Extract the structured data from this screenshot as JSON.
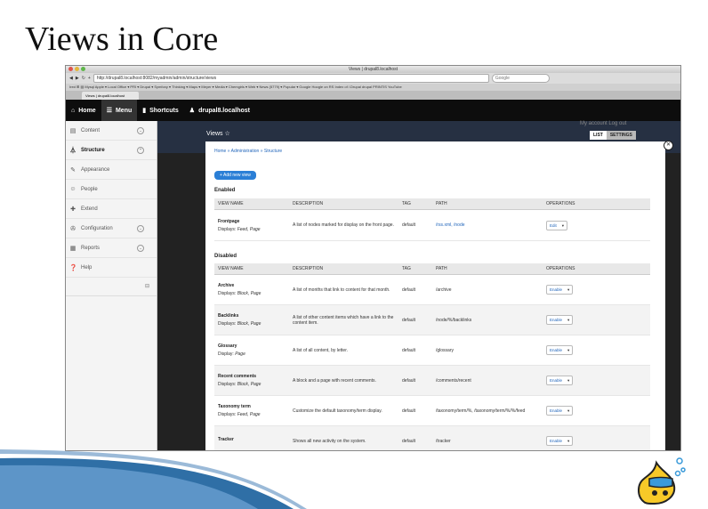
{
  "slide": {
    "title": "Views in Core"
  },
  "browser": {
    "window_title": "Views | drupal8.localhost",
    "url": "http://drupal8.localhost:8082/myadmin/admin/structure/views",
    "search_placeholder": "Google",
    "bookmarks": "Ired   ⊞  ▤   Mysql   Apple ▾   Local Office ▾   PRI ▾   Drupal ▾   Symfony ▾   Thinking ▾   Maps ▾   Meyer ▾   Media ▾   Chemgirls ▾   Web ▾   News (5779) ▾   Popular ▾   Google   Hoogle on RS   Index of /.Drupal drupal   PRINTIS   YouTube",
    "tab_label": "Views | drupal8.localhost"
  },
  "toolbar": {
    "home": "Home",
    "menu": "Menu",
    "shortcuts": "Shortcuts",
    "user": "drupal8.localhost"
  },
  "sidebar": {
    "items": [
      {
        "label": "Content",
        "icon": "content-icon"
      },
      {
        "label": "Structure",
        "icon": "structure-icon"
      },
      {
        "label": "Appearance",
        "icon": "appearance-icon"
      },
      {
        "label": "People",
        "icon": "people-icon"
      },
      {
        "label": "Extend",
        "icon": "extend-icon"
      },
      {
        "label": "Configuration",
        "icon": "configuration-icon"
      },
      {
        "label": "Reports",
        "icon": "reports-icon"
      },
      {
        "label": "Help",
        "icon": "help-icon"
      }
    ]
  },
  "page": {
    "title": "Views ☆",
    "account_links": "My account    Log out",
    "tab_list": "LIST",
    "tab_settings": "SETTINGS",
    "breadcrumb": "Home » Administration » Structure",
    "add_button": "+ Add new view",
    "enabled_heading": "Enabled",
    "disabled_heading": "Disabled",
    "columns": [
      "VIEW NAME",
      "DESCRIPTION",
      "TAG",
      "PATH",
      "OPERATIONS"
    ]
  },
  "enabled_rows": [
    {
      "name": "Frontpage",
      "displays_label": "Displays:",
      "displays": "Feed, Page",
      "description": "A list of nodes marked for display on the front page.",
      "tag": "default",
      "path": "/rss.xml, /node",
      "op": "Edit"
    }
  ],
  "disabled_rows": [
    {
      "name": "Archive",
      "displays_label": "Displays:",
      "displays": "Block, Page",
      "description": "A list of months that link to content for that month.",
      "tag": "default",
      "path": "/archive",
      "op": "Enable"
    },
    {
      "name": "Backlinks",
      "displays_label": "Displays:",
      "displays": "Block, Page",
      "description": "A list of other content items which have a link to the content item.",
      "tag": "default",
      "path": "/node/%/backlinks",
      "op": "Enable"
    },
    {
      "name": "Glossary",
      "displays_label": "Display:",
      "displays": "Page",
      "description": "A list of all content, by letter.",
      "tag": "default",
      "path": "/glossary",
      "op": "Enable"
    },
    {
      "name": "Recent comments",
      "displays_label": "Displays:",
      "displays": "Block, Page",
      "description": "A block and a page with recent comments.",
      "tag": "default",
      "path": "/comments/recent",
      "op": "Enable"
    },
    {
      "name": "Taxonomy term",
      "displays_label": "Displays:",
      "displays": "Feed, Page",
      "description": "Customize the default taxonomy/term display.",
      "tag": "default",
      "path": "/taxonomy/term/%, /taxonomy/term/%/%/feed",
      "op": "Enable"
    },
    {
      "name": "Tracker",
      "displays_label": "",
      "displays": "",
      "description": "Shows all new activity on the system.",
      "tag": "default",
      "path": "/tracker",
      "op": "Enable"
    }
  ],
  "colors": {
    "accent": "#2b7fd6",
    "toolbar": "#0d0d0d",
    "header": "#263042",
    "link": "#2266bb"
  },
  "decor": {
    "swoosh": "blue-swoosh-graphic",
    "logo": "drupal-drop-logo"
  }
}
